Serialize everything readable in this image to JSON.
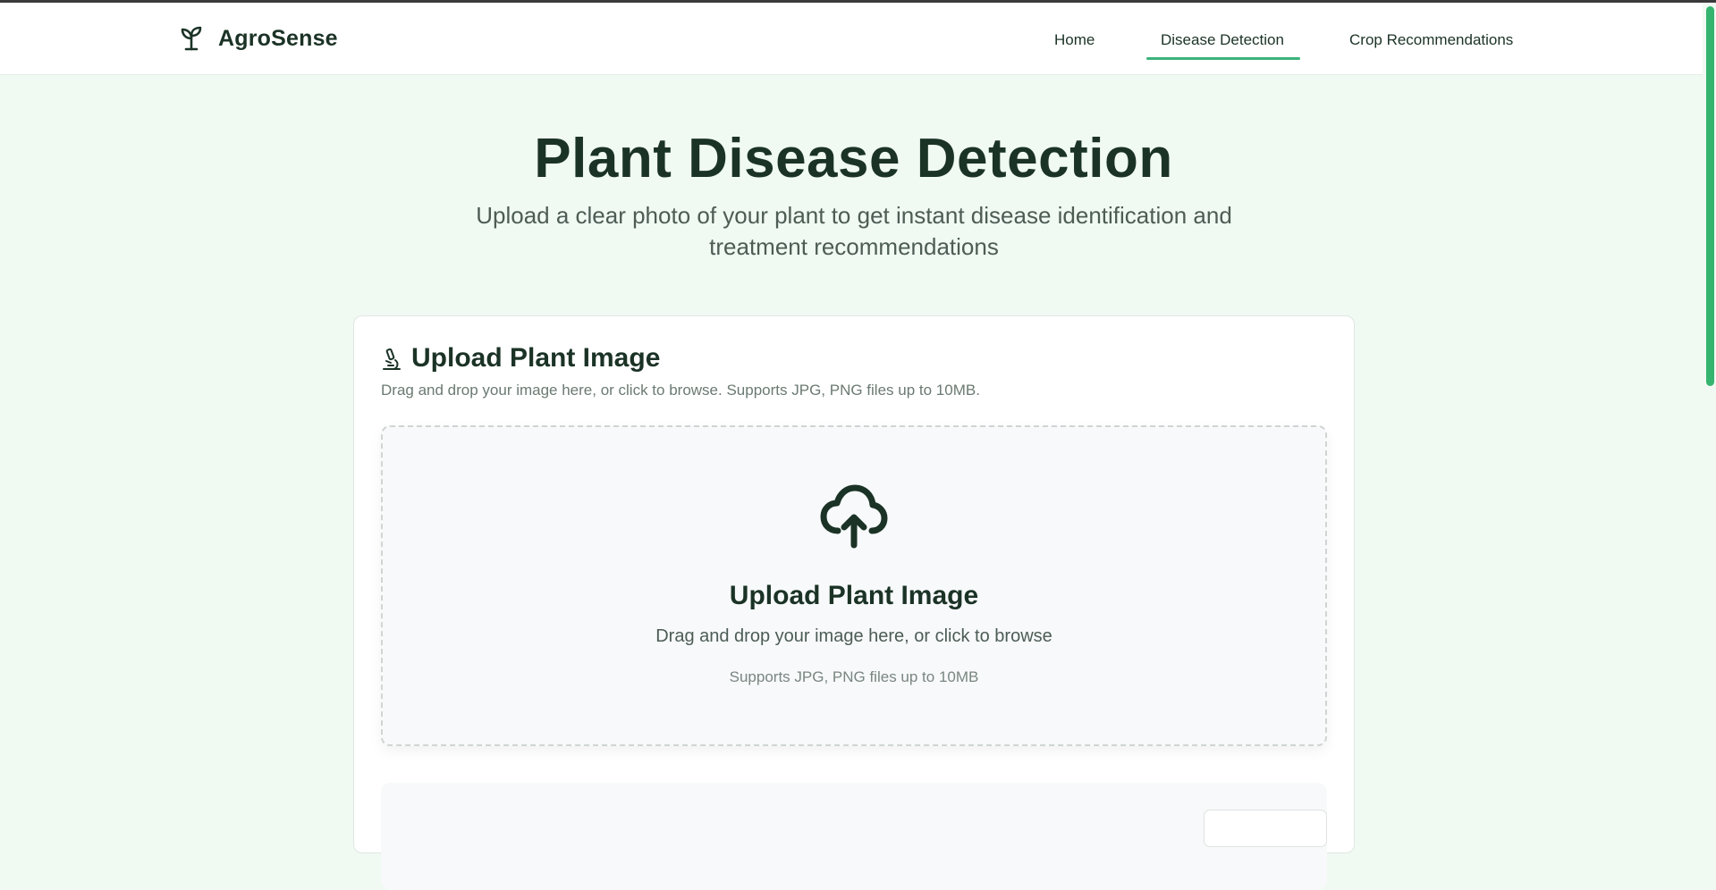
{
  "brand": {
    "name": "AgroSense",
    "logo_icon": "sprout-icon"
  },
  "nav": {
    "items": [
      {
        "label": "Home",
        "active": false
      },
      {
        "label": "Disease Detection",
        "active": true
      },
      {
        "label": "Crop Recommendations",
        "active": false
      }
    ],
    "active_color": "#3bb37a"
  },
  "hero": {
    "title": "Plant Disease Detection",
    "subtitle": "Upload a clear photo of your plant to get instant disease identification and treatment recommendations"
  },
  "upload_card": {
    "icon": "microscope-icon",
    "title": "Upload Plant Image",
    "description": "Drag and drop your image here, or click to browse. Supports JPG, PNG files up to 10MB.",
    "dropzone": {
      "icon": "upload-cloud-icon",
      "title": "Upload Plant Image",
      "text": "Drag and drop your image here, or click to browse",
      "hint": "Supports JPG, PNG files up to 10MB"
    }
  },
  "colors": {
    "page_background": "#f0faf2",
    "primary_text": "#1b3326",
    "accent": "#3bb37a",
    "scrollbar": "#35b46f"
  }
}
